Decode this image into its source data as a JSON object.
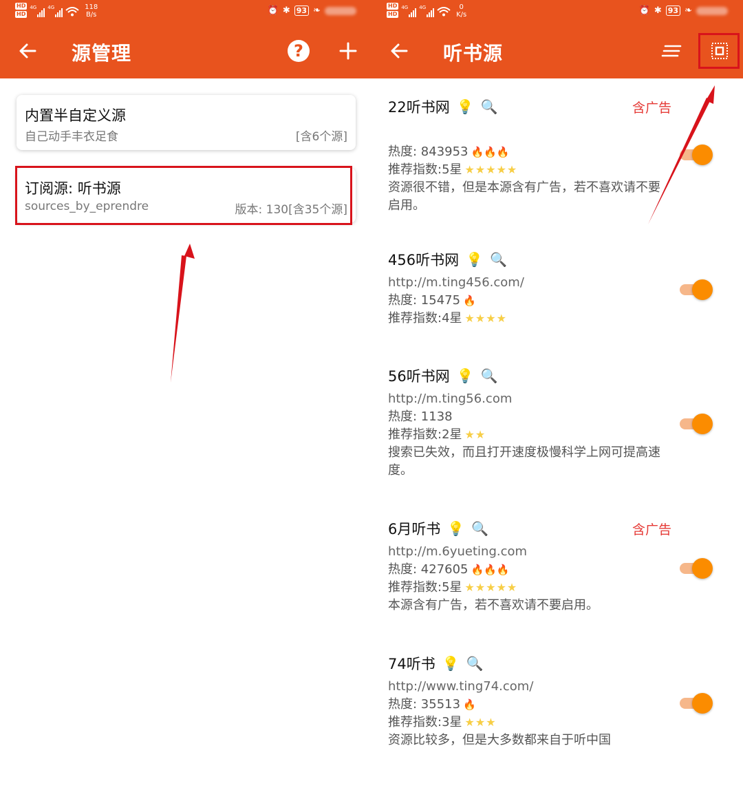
{
  "status_left": {
    "hd1": "HD",
    "hd2": "HD",
    "net1": "4G",
    "net2": "4G",
    "speed_value": "118",
    "speed_unit": "B/s",
    "battery": "93"
  },
  "status_right": {
    "hd1": "HD",
    "hd2": "HD",
    "net1": "4G",
    "net2": "4G",
    "speed_value": "0",
    "speed_unit": "K/s",
    "battery": "93"
  },
  "left_screen": {
    "title": "源管理",
    "help_label": "?",
    "cards": [
      {
        "title": "内置半自定义源",
        "subtitle": "自己动手丰衣足食",
        "meta": "[含6个源]"
      },
      {
        "title": "订阅源: 听书源",
        "subtitle": "sources_by_eprendre",
        "meta": "版本: 130[含35个源]"
      }
    ]
  },
  "right_screen": {
    "title": "听书源",
    "sources": [
      {
        "name": "22听书网",
        "ad": "含广告",
        "url": "",
        "heat": "热度: 843953",
        "flames": "🔥🔥🔥",
        "rating": "推荐指数:5星",
        "stars": "★★★★★",
        "desc": "资源很不错，但是本源含有广告，若不喜欢请不要启用。",
        "enabled": true
      },
      {
        "name": "456听书网",
        "ad": "",
        "url": "http://m.ting456.com/",
        "heat": "热度: 15475",
        "flames": "🔥",
        "rating": "推荐指数:4星",
        "stars": "★★★★",
        "desc": "",
        "enabled": true
      },
      {
        "name": "56听书网",
        "ad": "",
        "url": "http://m.ting56.com",
        "heat": "热度: 1138",
        "flames": "",
        "rating": "推荐指数:2星",
        "stars": "★★",
        "desc": "搜索已失效，而且打开速度极慢科学上网可提高速度。",
        "enabled": true
      },
      {
        "name": "6月听书",
        "ad": "含广告",
        "url": "http://m.6yueting.com",
        "heat": "热度: 427605",
        "flames": "🔥🔥🔥",
        "rating": "推荐指数:5星",
        "stars": "★★★★★",
        "desc": "本源含有广告，若不喜欢请不要启用。",
        "enabled": true
      },
      {
        "name": "74听书",
        "ad": "",
        "url": "http://www.ting74.com/",
        "heat": "热度: 35513",
        "flames": "🔥",
        "rating": "推荐指数:3星",
        "stars": "★★★",
        "desc": "资源比较多，但是大多数都来自于听中国",
        "enabled": true
      }
    ]
  },
  "icons": {
    "source_bulb": "lightbulb-icon",
    "source_search": "magnifier-icon"
  },
  "colors": {
    "appbar": "#e8531e",
    "highlight_box": "#d8131b",
    "ad_text": "#e53935",
    "toggle_on": "#fb8c00"
  }
}
